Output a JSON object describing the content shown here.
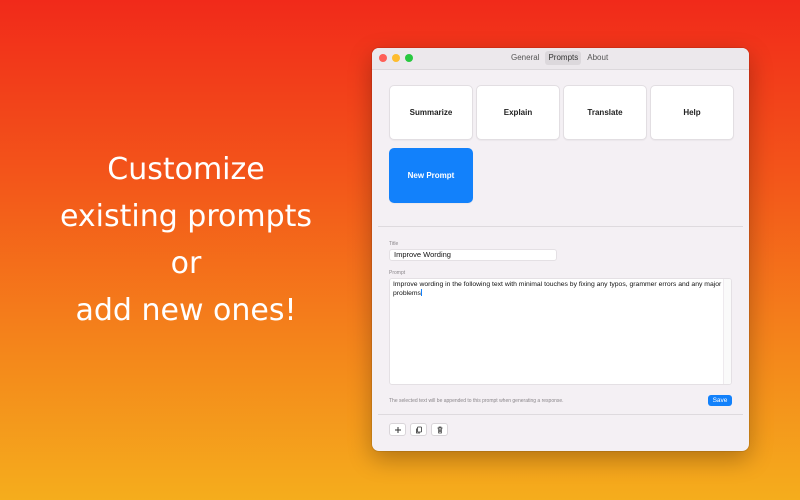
{
  "promo": {
    "lines": [
      "Customize",
      "existing prompts",
      "or",
      "add new ones!"
    ]
  },
  "window": {
    "tabs": [
      "General",
      "Prompts",
      "About"
    ],
    "active_tab": "Prompts",
    "prompt_cards": [
      "Summarize",
      "Explain",
      "Translate",
      "Help"
    ],
    "new_prompt_label": "New Prompt",
    "title_label": "Title",
    "title_value": "Improve Wording",
    "prompt_label": "Prompt",
    "prompt_value": "Improve wording in the following text with minimal touches by fixing any typos, grammer errors and any major problems",
    "hint": "The selected text will be appended to this prompt when generating a response.",
    "save_label": "Save",
    "toolbar_icons": [
      "plus-icon",
      "copy-icon",
      "trash-icon"
    ]
  },
  "colors": {
    "accent": "#1281fb",
    "gradient_top": "#f12a1a",
    "gradient_bottom": "#f5ad1c"
  }
}
